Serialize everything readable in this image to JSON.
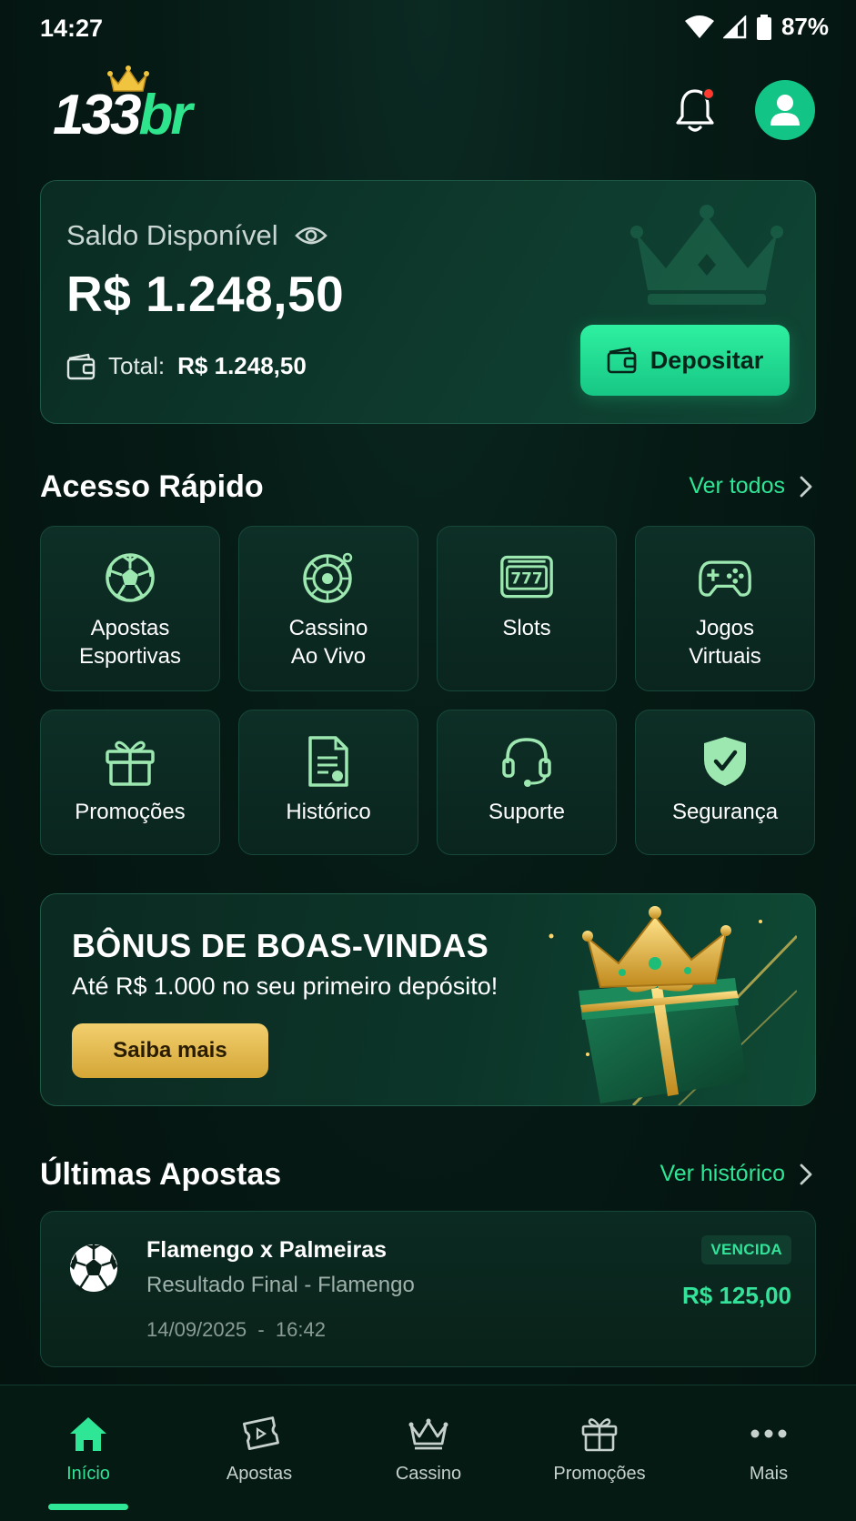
{
  "status_bar": {
    "time": "14:27",
    "battery": "87%"
  },
  "header": {
    "logo": {
      "number": "133",
      "suffix": "br"
    }
  },
  "balance": {
    "label": "Saldo Disponível",
    "amount": "R$ 1.248,50",
    "total_prefix": "Total:",
    "total_value": "R$ 1.248,50",
    "deposit_label": "Depositar"
  },
  "quick_access": {
    "title": "Acesso Rápido",
    "link": "Ver todos",
    "items": [
      {
        "label": "Apostas\nEsportivas",
        "icon": "soccer-ball-icon"
      },
      {
        "label": "Cassino\nAo Vivo",
        "icon": "roulette-icon"
      },
      {
        "label": "Slots",
        "icon": "slot-machine-icon"
      },
      {
        "label": "Jogos\nVirtuais",
        "icon": "gamepad-icon"
      },
      {
        "label": "Promoções",
        "icon": "gift-icon"
      },
      {
        "label": "Histórico",
        "icon": "document-icon"
      },
      {
        "label": "Suporte",
        "icon": "headset-icon"
      },
      {
        "label": "Segurança",
        "icon": "shield-icon"
      }
    ]
  },
  "promo": {
    "title": "BÔNUS DE BOAS-VINDAS",
    "subtitle": "Até R$ 1.000 no seu primeiro depósito!",
    "button": "Saiba mais"
  },
  "latest_bets": {
    "title": "Últimas Apostas",
    "link": "Ver histórico",
    "items": [
      {
        "match": "Flamengo x Palmeiras",
        "market": "Resultado Final - Flamengo",
        "date": "14/09/2025",
        "time": "16:42",
        "datetime": "14/09/2025  -  16:42",
        "status": "VENCIDA",
        "amount": "R$ 125,00"
      }
    ]
  },
  "bottom_nav": {
    "items": [
      {
        "label": "Início",
        "icon": "home-icon",
        "active": true
      },
      {
        "label": "Apostas",
        "icon": "ticket-icon",
        "active": false
      },
      {
        "label": "Cassino",
        "icon": "crown-icon",
        "active": false
      },
      {
        "label": "Promoções",
        "icon": "gift-icon",
        "active": false
      },
      {
        "label": "Mais",
        "icon": "more-icon",
        "active": false
      }
    ]
  },
  "colors": {
    "accent": "#2fe596",
    "background": "#061a15",
    "gold": "#e0b84a",
    "alert": "#ff3b30"
  }
}
